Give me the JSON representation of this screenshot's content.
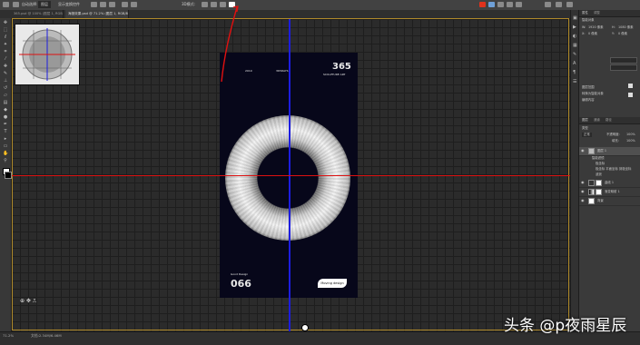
{
  "options_bar": {
    "auto_select_label": "自动选择:",
    "layer_select_value": "图层",
    "transform_label": "显示变换控件",
    "mode_label": "3D模式:"
  },
  "tabs": [
    {
      "label": "365.psd @ 100% (图层 1, RGB/8)",
      "active": false
    },
    {
      "label": "未标题-1 @ 66.7% (RGB/8)",
      "active": false
    },
    {
      "label": "海报效果.psd @ 71.2% (图层 1, RGB/8#)",
      "active": true
    }
  ],
  "artboard": {
    "top_left": "2019",
    "top_center": "365DAYS",
    "big_number": "365",
    "sub_caption": "SCULPTURE ART",
    "bottom_caption": "Good Design",
    "bottom_number": "066",
    "badge_label": "Moving design"
  },
  "panels": {
    "properties": {
      "title": "属性",
      "tabs": [
        "属性",
        "调整"
      ],
      "section": "智能对象",
      "w_label": "W:",
      "w_value": "1920 像素",
      "h_label": "H:",
      "h_value": "1080 像素",
      "x_label": "X:",
      "x_value": "0 像素",
      "y_label": "Y:",
      "y_value": "0 像素",
      "check1": "图层范围",
      "check2": "转换为智能对象",
      "check3": "编辑内容"
    },
    "layers": {
      "tabs": [
        "图层",
        "通道",
        "路径"
      ],
      "filter_label": "类型",
      "blend_mode": "正常",
      "opacity_label": "不透明度:",
      "opacity_value": "100%",
      "fill_label": "填充:",
      "fill_value": "100%",
      "items": [
        {
          "name": "图层 1",
          "selected": true
        },
        {
          "name": "智能滤镜",
          "selected": false
        },
        {
          "name": "极坐标",
          "selected": false
        },
        {
          "name": "极坐标 平面坐标 到极坐标",
          "selected": false
        },
        {
          "name": "波浪",
          "selected": false
        },
        {
          "name": "曲线 1",
          "selected": false
        },
        {
          "name": "渐变映射 1",
          "selected": false
        },
        {
          "name": "背景",
          "selected": false
        }
      ]
    }
  },
  "status": {
    "zoom": "71.2%",
    "doc_info": "文档:2.34M/6.46M"
  },
  "watermark": "头条 @p夜雨星辰"
}
